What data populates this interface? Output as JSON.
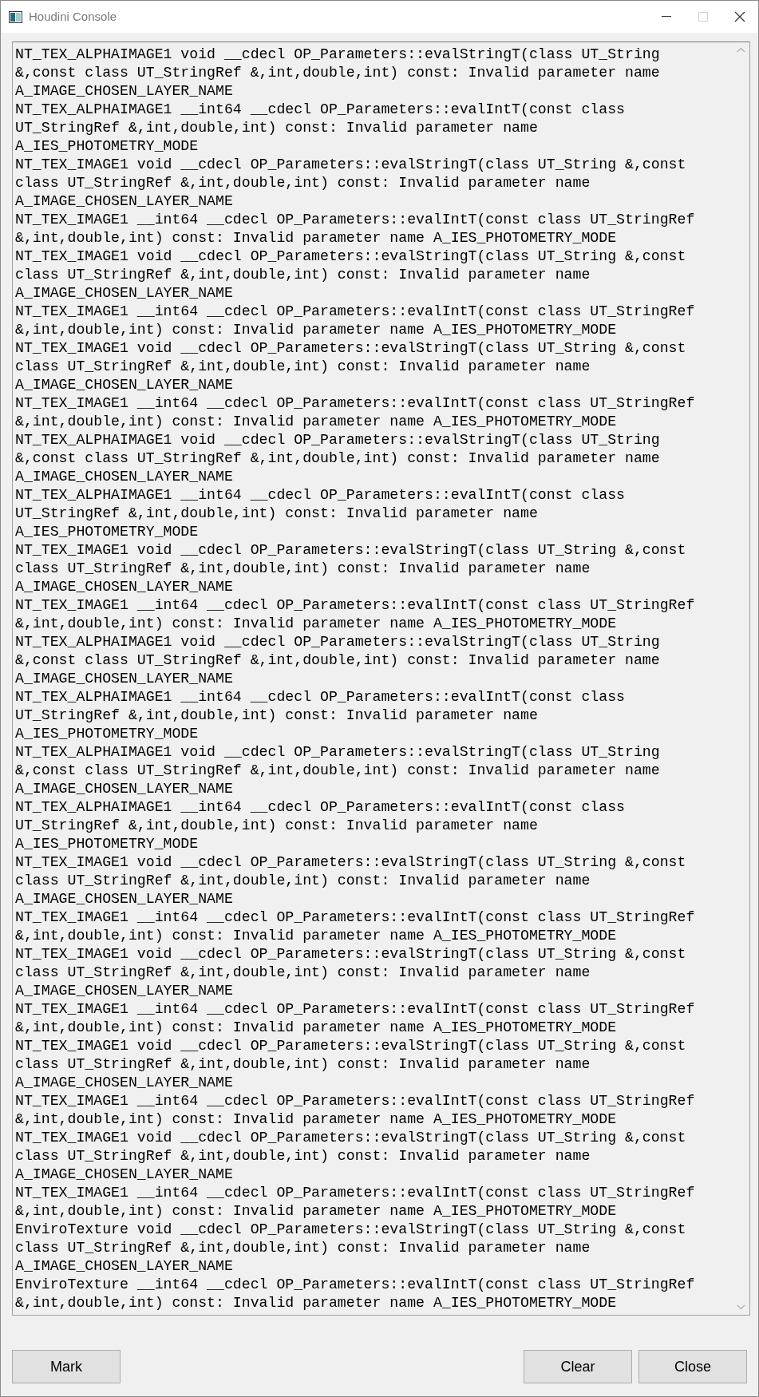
{
  "window": {
    "title": "Houdini Console",
    "maximize_disabled": true
  },
  "messages": [
    {
      "lines": [
        "NT_TEX_ALPHAIMAGE1 void __cdecl OP_Parameters::evalStringT(class UT_String",
        "&,const class UT_StringRef &,int,double,int) const: Invalid parameter name",
        "A_IMAGE_CHOSEN_LAYER_NAME"
      ]
    },
    {
      "lines": [
        "NT_TEX_ALPHAIMAGE1 __int64 __cdecl OP_Parameters::evalIntT(const class",
        "UT_StringRef &,int,double,int) const: Invalid parameter name",
        "A_IES_PHOTOMETRY_MODE"
      ]
    },
    {
      "lines": [
        "NT_TEX_IMAGE1 void __cdecl OP_Parameters::evalStringT(class UT_String &,const",
        "class UT_StringRef &,int,double,int) const: Invalid parameter name",
        "A_IMAGE_CHOSEN_LAYER_NAME"
      ]
    },
    {
      "lines": [
        "NT_TEX_IMAGE1 __int64 __cdecl OP_Parameters::evalIntT(const class UT_StringRef",
        "&,int,double,int) const: Invalid parameter name A_IES_PHOTOMETRY_MODE"
      ]
    },
    {
      "lines": [
        "NT_TEX_IMAGE1 void __cdecl OP_Parameters::evalStringT(class UT_String &,const",
        "class UT_StringRef &,int,double,int) const: Invalid parameter name",
        "A_IMAGE_CHOSEN_LAYER_NAME"
      ]
    },
    {
      "lines": [
        "NT_TEX_IMAGE1 __int64 __cdecl OP_Parameters::evalIntT(const class UT_StringRef",
        "&,int,double,int) const: Invalid parameter name A_IES_PHOTOMETRY_MODE"
      ]
    },
    {
      "lines": [
        "NT_TEX_IMAGE1 void __cdecl OP_Parameters::evalStringT(class UT_String &,const",
        "class UT_StringRef &,int,double,int) const: Invalid parameter name",
        "A_IMAGE_CHOSEN_LAYER_NAME"
      ]
    },
    {
      "lines": [
        "NT_TEX_IMAGE1 __int64 __cdecl OP_Parameters::evalIntT(const class UT_StringRef",
        "&,int,double,int) const: Invalid parameter name A_IES_PHOTOMETRY_MODE"
      ]
    },
    {
      "lines": [
        "NT_TEX_ALPHAIMAGE1 void __cdecl OP_Parameters::evalStringT(class UT_String",
        "&,const class UT_StringRef &,int,double,int) const: Invalid parameter name",
        "A_IMAGE_CHOSEN_LAYER_NAME"
      ]
    },
    {
      "lines": [
        "NT_TEX_ALPHAIMAGE1 __int64 __cdecl OP_Parameters::evalIntT(const class",
        "UT_StringRef &,int,double,int) const: Invalid parameter name",
        "A_IES_PHOTOMETRY_MODE"
      ]
    },
    {
      "lines": [
        "NT_TEX_IMAGE1 void __cdecl OP_Parameters::evalStringT(class UT_String &,const",
        "class UT_StringRef &,int,double,int) const: Invalid parameter name",
        "A_IMAGE_CHOSEN_LAYER_NAME"
      ]
    },
    {
      "lines": [
        "NT_TEX_IMAGE1 __int64 __cdecl OP_Parameters::evalIntT(const class UT_StringRef",
        "&,int,double,int) const: Invalid parameter name A_IES_PHOTOMETRY_MODE"
      ]
    },
    {
      "lines": [
        "NT_TEX_ALPHAIMAGE1 void __cdecl OP_Parameters::evalStringT(class UT_String",
        "&,const class UT_StringRef &,int,double,int) const: Invalid parameter name",
        "A_IMAGE_CHOSEN_LAYER_NAME"
      ]
    },
    {
      "lines": [
        "NT_TEX_ALPHAIMAGE1 __int64 __cdecl OP_Parameters::evalIntT(const class",
        "UT_StringRef &,int,double,int) const: Invalid parameter name",
        "A_IES_PHOTOMETRY_MODE"
      ]
    },
    {
      "lines": [
        "NT_TEX_ALPHAIMAGE1 void __cdecl OP_Parameters::evalStringT(class UT_String",
        "&,const class UT_StringRef &,int,double,int) const: Invalid parameter name",
        "A_IMAGE_CHOSEN_LAYER_NAME"
      ]
    },
    {
      "lines": [
        "NT_TEX_ALPHAIMAGE1 __int64 __cdecl OP_Parameters::evalIntT(const class",
        "UT_StringRef &,int,double,int) const: Invalid parameter name",
        "A_IES_PHOTOMETRY_MODE"
      ]
    },
    {
      "lines": [
        "NT_TEX_IMAGE1 void __cdecl OP_Parameters::evalStringT(class UT_String &,const",
        "class UT_StringRef &,int,double,int) const: Invalid parameter name",
        "A_IMAGE_CHOSEN_LAYER_NAME"
      ]
    },
    {
      "lines": [
        "NT_TEX_IMAGE1 __int64 __cdecl OP_Parameters::evalIntT(const class UT_StringRef",
        "&,int,double,int) const: Invalid parameter name A_IES_PHOTOMETRY_MODE"
      ]
    },
    {
      "lines": [
        "NT_TEX_IMAGE1 void __cdecl OP_Parameters::evalStringT(class UT_String &,const",
        "class UT_StringRef &,int,double,int) const: Invalid parameter name",
        "A_IMAGE_CHOSEN_LAYER_NAME"
      ]
    },
    {
      "lines": [
        "NT_TEX_IMAGE1 __int64 __cdecl OP_Parameters::evalIntT(const class UT_StringRef",
        "&,int,double,int) const: Invalid parameter name A_IES_PHOTOMETRY_MODE"
      ]
    },
    {
      "lines": [
        "NT_TEX_IMAGE1 void __cdecl OP_Parameters::evalStringT(class UT_String &,const",
        "class UT_StringRef &,int,double,int) const: Invalid parameter name",
        "A_IMAGE_CHOSEN_LAYER_NAME"
      ]
    },
    {
      "lines": [
        "NT_TEX_IMAGE1 __int64 __cdecl OP_Parameters::evalIntT(const class UT_StringRef",
        "&,int,double,int) const: Invalid parameter name A_IES_PHOTOMETRY_MODE"
      ]
    },
    {
      "lines": [
        "NT_TEX_IMAGE1 void __cdecl OP_Parameters::evalStringT(class UT_String &,const",
        "class UT_StringRef &,int,double,int) const: Invalid parameter name",
        "A_IMAGE_CHOSEN_LAYER_NAME"
      ]
    },
    {
      "lines": [
        "NT_TEX_IMAGE1 __int64 __cdecl OP_Parameters::evalIntT(const class UT_StringRef",
        "&,int,double,int) const: Invalid parameter name A_IES_PHOTOMETRY_MODE"
      ]
    },
    {
      "lines": [
        "EnviroTexture void __cdecl OP_Parameters::evalStringT(class UT_String &,const",
        "class UT_StringRef &,int,double,int) const: Invalid parameter name",
        "A_IMAGE_CHOSEN_LAYER_NAME"
      ]
    },
    {
      "lines": [
        "EnviroTexture __int64 __cdecl OP_Parameters::evalIntT(const class UT_StringRef",
        "&,int,double,int) const: Invalid parameter name A_IES_PHOTOMETRY_MODE"
      ]
    }
  ],
  "buttons_left": [
    "Mark"
  ],
  "buttons_right": [
    "Clear",
    "Close"
  ]
}
